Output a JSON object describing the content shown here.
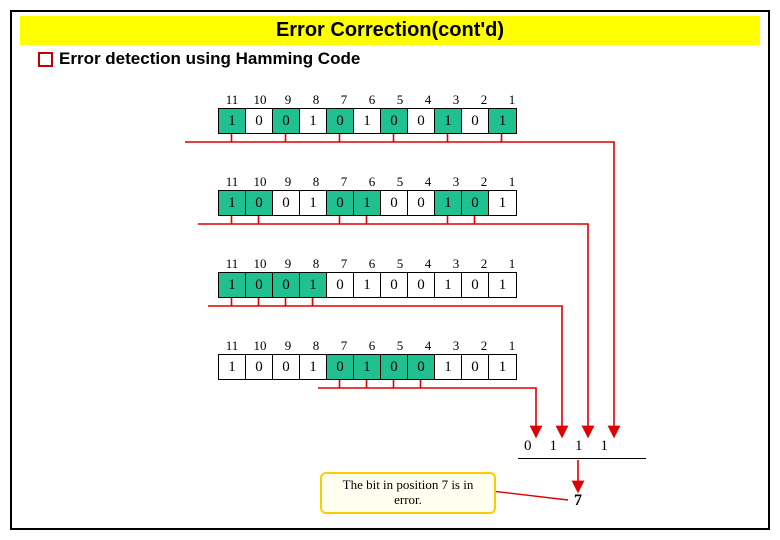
{
  "title": "Error Correction(cont'd)",
  "bullet": "Error detection using Hamming Code",
  "positions": [
    "11",
    "10",
    "9",
    "8",
    "7",
    "6",
    "5",
    "4",
    "3",
    "2",
    "1"
  ],
  "codeword": [
    "1",
    "0",
    "0",
    "1",
    "0",
    "1",
    "0",
    "0",
    "1",
    "0",
    "1"
  ],
  "rows": [
    {
      "green_idx": [
        0,
        2,
        4,
        6,
        8,
        10
      ]
    },
    {
      "green_idx": [
        0,
        1,
        4,
        5,
        8,
        9
      ]
    },
    {
      "green_idx": [
        0,
        1,
        2,
        3
      ]
    },
    {
      "green_idx": [
        4,
        5,
        6,
        7
      ]
    }
  ],
  "result_bits": [
    "0",
    "1",
    "1",
    "1"
  ],
  "result_value": "7",
  "note": "The bit in position 7 is in error."
}
